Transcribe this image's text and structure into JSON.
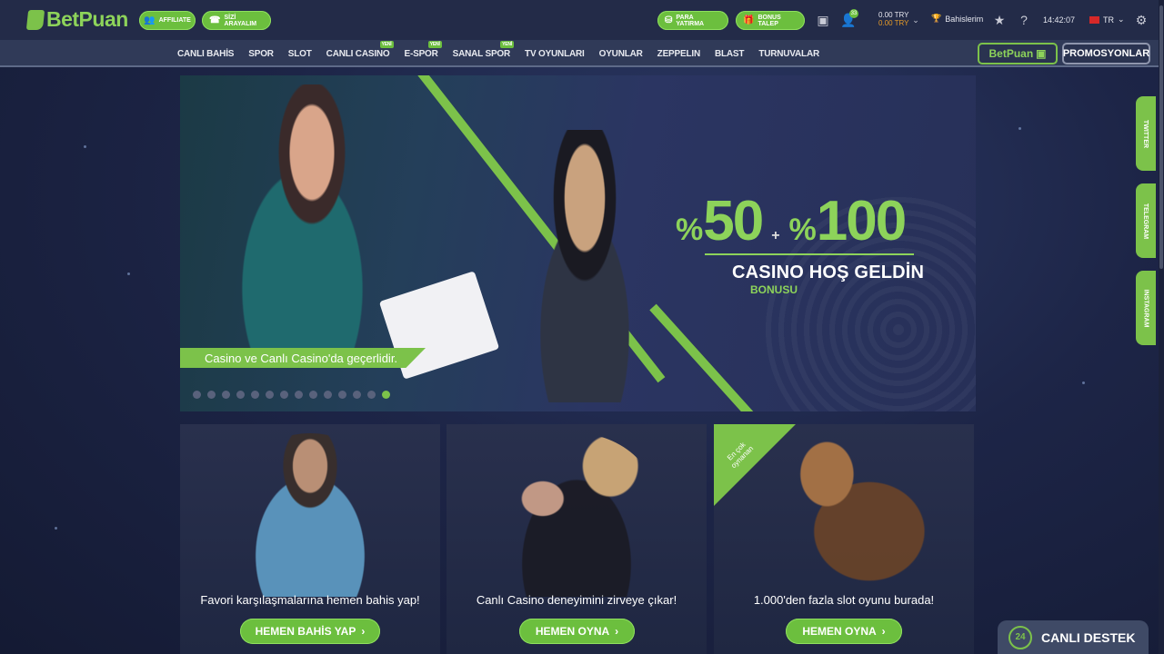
{
  "brand": {
    "name": "BetPuan",
    "accent": "#6cbf3e"
  },
  "topbar": {
    "affiliate": "AFFILIATE",
    "callback": "SİZİ ARAYALIM",
    "deposit": "PARA YATIRMA",
    "bonus": "BONUS TALEP",
    "notification_count": "33",
    "balance_main": "0.00 TRY",
    "balance_bonus": "0.00 TRY",
    "my_bets": "Bahislerim",
    "time": "14:42:07",
    "language": "TR"
  },
  "nav": {
    "items": [
      {
        "label": "CANLI BAHİS",
        "new": ""
      },
      {
        "label": "SPOR",
        "new": ""
      },
      {
        "label": "SLOT",
        "new": ""
      },
      {
        "label": "CANLI CASINO",
        "new": "YENİ"
      },
      {
        "label": "E-SPOR",
        "new": "YENİ"
      },
      {
        "label": "SANAL SPOR",
        "new": "YENİ"
      },
      {
        "label": "TV OYUNLARI",
        "new": ""
      },
      {
        "label": "OYUNLAR",
        "new": ""
      },
      {
        "label": "ZEPPELIN",
        "new": ""
      },
      {
        "label": "BLAST",
        "new": ""
      },
      {
        "label": "TURNUVALAR",
        "new": ""
      }
    ],
    "tv_button": "BetPuan",
    "promotions": "PROMOSYONLAR"
  },
  "hero": {
    "pct_sign": "%",
    "offer1": "50",
    "plus": "+",
    "offer2": "100",
    "title": "CASINO HOŞ GELDİN",
    "subtitle": "BONUSU",
    "caption": "Casino ve Canlı Casino'da geçerlidir.",
    "slide_count": 14,
    "active_slide": 14
  },
  "cards": [
    {
      "text": "Favori karşılaşmalarına hemen bahis yap!",
      "button": "HEMEN BAHİS YAP"
    },
    {
      "text": "Canlı Casino deneyimini zirveye çıkar!",
      "button": "HEMEN OYNA"
    },
    {
      "text": "1.000'den fazla slot oyunu burada!",
      "button": "HEMEN OYNA",
      "ribbon": "En çok oynanan"
    }
  ],
  "social": [
    "TWITTER",
    "TELEGRAM",
    "INSTAGRAM"
  ],
  "support": {
    "icon_label": "24",
    "label": "CANLI DESTEK"
  }
}
